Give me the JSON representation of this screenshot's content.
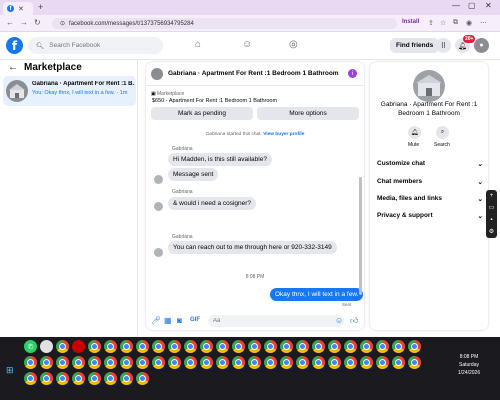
{
  "browser": {
    "url": "facebook.com/messages/t/1373756934795284",
    "install_label": "Install"
  },
  "header": {
    "logo": "f",
    "search_placeholder": "Search Facebook",
    "find_friends": "Find friends",
    "notif_badge": "20+"
  },
  "left": {
    "title": "Marketplace",
    "conversation": {
      "name": "Gabriana · Apartment For Rent :1 B...",
      "snippet": "You: Okay thnx, I will text in a few. · 1m"
    }
  },
  "chat": {
    "title": "Gabriana · Apartment For Rent :1 Bedroom 1 Bathroom",
    "listing_label": "Marketplace",
    "listing_title": "$650 - Apartment For Rent :1 Bedroom 1 Bathroom",
    "mark_pending": "Mark as pending",
    "more_options": "More options",
    "started_text": "Gabriana started this chat.",
    "view_profile": "View buyer profile",
    "messages": [
      {
        "sender": "Gabriana",
        "text": "Hi Madden, is this still available?"
      },
      {
        "sender": "",
        "text": "Message sent"
      },
      {
        "sender": "Gabriana",
        "text": "& would i need a cosigner?"
      },
      {
        "sender": "Gabriana",
        "text": "You can reach out to me through here or 920-332-3149"
      }
    ],
    "timestamp": "8:08 PM",
    "outgoing": "Okay thnx, I will text in a few.",
    "sent_label": "Sent",
    "input_placeholder": "Aa"
  },
  "right": {
    "title": "Gabriana · Apartment For Rent :1 Bedroom 1 Bathroom",
    "mute": "Mute",
    "search": "Search",
    "rows": [
      "Customize chat",
      "Chat members",
      "Media, files and links",
      "Privacy & support"
    ]
  },
  "taskbar": {
    "time": "8:08 PM",
    "day": "Saturday",
    "date": "1/24/2026"
  }
}
